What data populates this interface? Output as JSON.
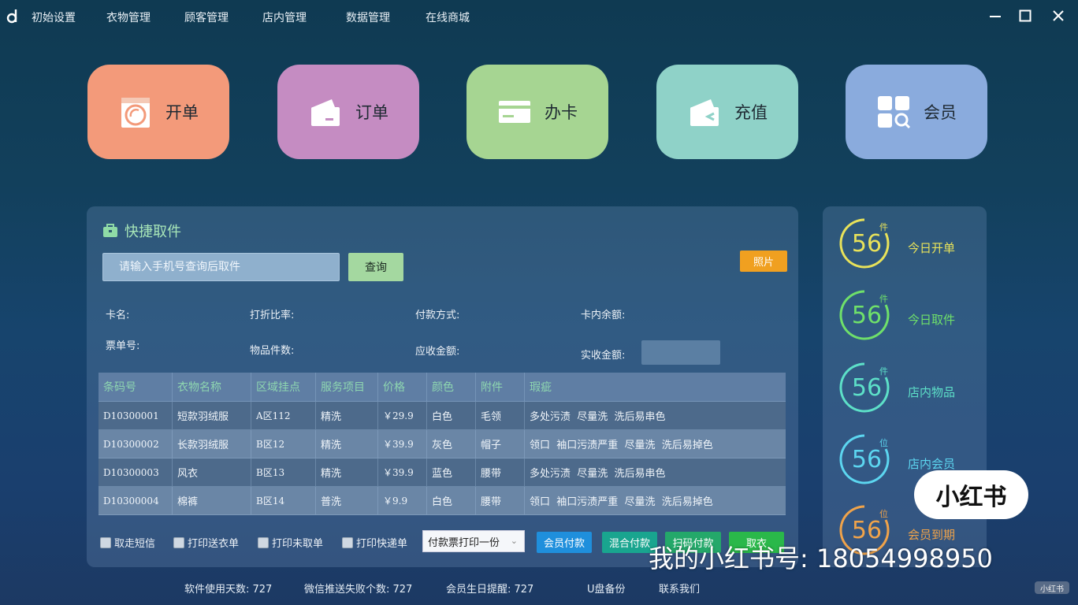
{
  "menu": [
    "初始设置",
    "衣物管理",
    "顾客管理",
    "店内管理",
    "数据管理",
    "在线商城"
  ],
  "window_controls": [
    "minimize-icon",
    "maximize-icon",
    "close-icon"
  ],
  "tiles": [
    {
      "label": "开单",
      "color": "#f39a7a",
      "icon": "washing-machine-icon"
    },
    {
      "label": "订单",
      "color": "#c58cc2",
      "icon": "wallet-icon"
    },
    {
      "label": "办卡",
      "color": "#a6d592",
      "icon": "card-icon"
    },
    {
      "label": "充值",
      "color": "#8fd2c8",
      "icon": "wallet-return-icon"
    },
    {
      "label": "会员",
      "color": "#8aabdd",
      "icon": "grid-search-icon"
    }
  ],
  "pickup": {
    "title": "快捷取件",
    "search_placeholder": "请输入手机号查询后取件",
    "query_label": "查询",
    "photo_label": "照片",
    "info": {
      "card_name": "卡名:",
      "discount": "打折比率:",
      "pay_method": "付款方式:",
      "card_balance": "卡内余额:",
      "ticket_no": "票单号:",
      "item_count": "物品件数:",
      "receivable": "应收金额:",
      "received": "实收金额:"
    },
    "columns": [
      "条码号",
      "衣物名称",
      "区域挂点",
      "服务项目",
      "价格",
      "颜色",
      "附件",
      "瑕疵"
    ],
    "rows": [
      [
        "D10300001",
        "短款羽绒服",
        "A区112",
        "精洗",
        "￥29.9",
        "白色",
        "毛领",
        "多处污渍  尽量洗  洗后易串色"
      ],
      [
        "D10300002",
        "长款羽绒服",
        "B区12",
        "精洗",
        "￥39.9",
        "灰色",
        "帽子",
        "领口  袖口污渍严重  尽量洗  洗后易掉色"
      ],
      [
        "D10300003",
        "风衣",
        "B区13",
        "精洗",
        "￥39.9",
        "蓝色",
        "腰带",
        "多处污渍  尽量洗  洗后易串色"
      ],
      [
        "D10300004",
        "棉裤",
        "B区14",
        "普洗",
        "￥9.9",
        "白色",
        "腰带",
        "领口  袖口污渍严重  尽量洗  洗后易掉色"
      ]
    ],
    "options": [
      "取走短信",
      "打印送衣单",
      "打印未取单",
      "打印快递单"
    ],
    "print_select": "付款票打印一份",
    "pay_buttons": [
      {
        "label": "会员付款",
        "color": "#1f8fdc"
      },
      {
        "label": "混合付款",
        "color": "#19a58f"
      },
      {
        "label": "扫码付款",
        "color": "#24a86a"
      },
      {
        "label": "取衣",
        "color": "#2ab84a"
      }
    ]
  },
  "stats": [
    {
      "value": "56",
      "unit": "件",
      "label": "今日开单",
      "color": "#e8e25a"
    },
    {
      "value": "56",
      "unit": "件",
      "label": "今日取件",
      "color": "#6fe06a"
    },
    {
      "value": "56",
      "unit": "件",
      "label": "店内物品",
      "color": "#5de0c8"
    },
    {
      "value": "56",
      "unit": "位",
      "label": "店内会员",
      "color": "#5cd6f0"
    },
    {
      "value": "56",
      "unit": "位",
      "label": "会员到期",
      "color": "#f0a34a"
    }
  ],
  "footer": [
    "软件使用天数: 727",
    "微信推送失败个数: 727",
    "会员生日提醒: 727",
    "U盘备份",
    "联系我们"
  ],
  "watermark": {
    "badge": "小红书",
    "text": "我的小红书号:  18054998950",
    "corner": "小红书"
  }
}
